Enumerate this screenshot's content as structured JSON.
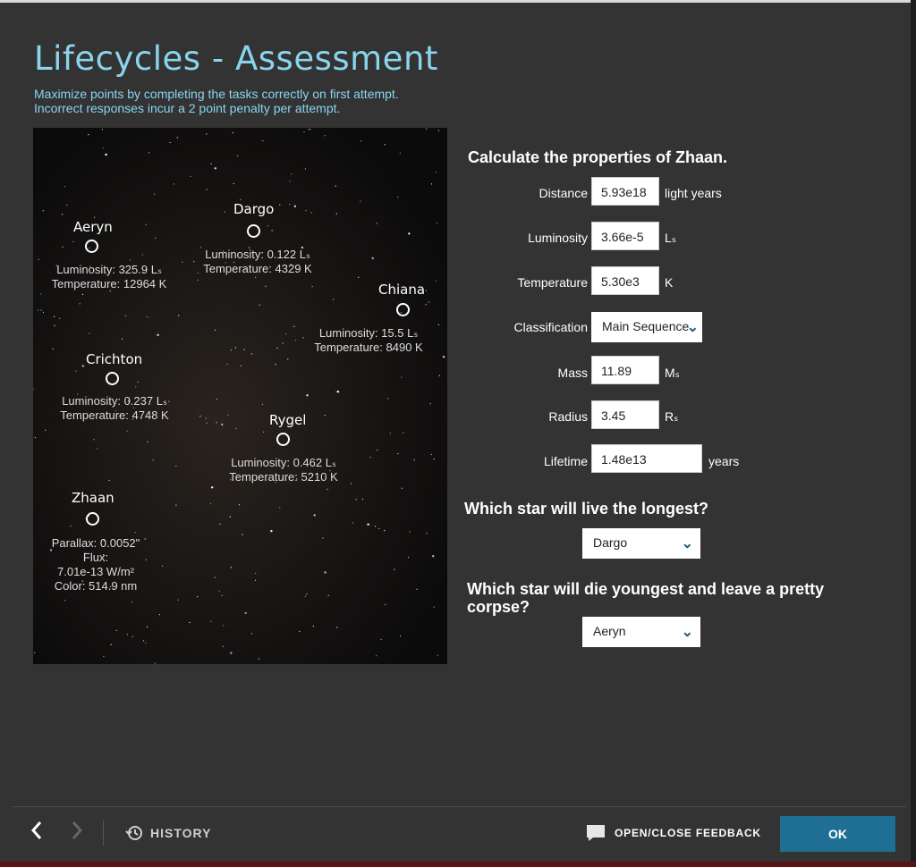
{
  "header": {
    "title": "Lifecycles - Assessment",
    "subtitle_line1": "Maximize points by completing the tasks correctly on first attempt.",
    "subtitle_line2": "Incorrect responses incur a 2 point penalty per attempt."
  },
  "stars": [
    {
      "name": "Aeryn",
      "info1": "Luminosity: 325.9 Lₛ",
      "info2": "Temperature: 12964 K",
      "info3": "",
      "info4": ""
    },
    {
      "name": "Dargo",
      "info1": "Luminosity: 0.122 Lₛ",
      "info2": "Temperature: 4329 K",
      "info3": "",
      "info4": ""
    },
    {
      "name": "Chiana",
      "info1": "Luminosity: 15.5 Lₛ",
      "info2": "Temperature: 8490 K",
      "info3": "",
      "info4": ""
    },
    {
      "name": "Crichton",
      "info1": "Luminosity: 0.237 Lₛ",
      "info2": "Temperature: 4748 K",
      "info3": "",
      "info4": ""
    },
    {
      "name": "Rygel",
      "info1": "Luminosity: 0.462 Lₛ",
      "info2": "Temperature: 5210 K",
      "info3": "",
      "info4": ""
    },
    {
      "name": "Zhaan",
      "info1": "Parallax: 0.0052\"",
      "info2": "Flux:",
      "info3": "7.01e-13 W/m²",
      "info4": "Color: 514.9 nm"
    }
  ],
  "form": {
    "heading": "Calculate the properties of Zhaan.",
    "fields": [
      {
        "label": "Distance",
        "value": "5.93e18",
        "unit": "light years"
      },
      {
        "label": "Luminosity",
        "value": "3.66e-5",
        "unit": "Lₛ"
      },
      {
        "label": "Temperature",
        "value": "5.30e3",
        "unit": "K"
      },
      {
        "label": "Classification",
        "value": "Main Sequence",
        "unit": ""
      },
      {
        "label": "Mass",
        "value": "11.89",
        "unit": "Mₛ"
      },
      {
        "label": "Radius",
        "value": "3.45",
        "unit": "Rₛ"
      },
      {
        "label": "Lifetime",
        "value": "1.48e13",
        "unit": "years"
      }
    ]
  },
  "questions": [
    {
      "text": "Which star will live the longest?",
      "text2": "",
      "answer": "Dargo"
    },
    {
      "text": "Which star will die youngest and leave a pretty",
      "text2": "corpse?",
      "answer": "Aeryn"
    }
  ],
  "footer": {
    "history_label": "HISTORY",
    "feedback_label": "OPEN/CLOSE FEEDBACK",
    "ok_label": "OK"
  },
  "colors": {
    "accent": "#8ad4ee",
    "ok_button": "#1f6f95",
    "background": "#333333"
  }
}
